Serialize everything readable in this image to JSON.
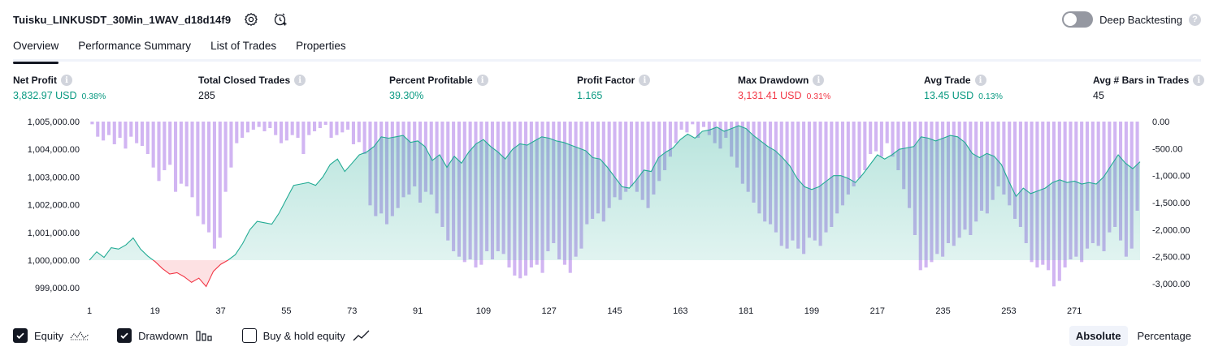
{
  "header": {
    "title": "Tuisku_LINKUSDT_30Min_1WAV_d18d14f9",
    "deep_backtesting_label": "Deep Backtesting",
    "deep_backtesting_enabled": false,
    "help_glyph": "?"
  },
  "tabs": [
    {
      "label": "Overview",
      "active": true
    },
    {
      "label": "Performance Summary",
      "active": false
    },
    {
      "label": "List of Trades",
      "active": false
    },
    {
      "label": "Properties",
      "active": false
    }
  ],
  "info_glyph": "i",
  "metrics": [
    {
      "label": "Net Profit",
      "value": "3,832.97 USD",
      "pct": "0.38%",
      "tone": "pos"
    },
    {
      "label": "Total Closed Trades",
      "value": "285",
      "pct": "",
      "tone": "neu"
    },
    {
      "label": "Percent Profitable",
      "value": "39.30%",
      "pct": "",
      "tone": "pos"
    },
    {
      "label": "Profit Factor",
      "value": "1.165",
      "pct": "",
      "tone": "pos"
    },
    {
      "label": "Max Drawdown",
      "value": "3,131.41 USD",
      "pct": "0.31%",
      "tone": "neg"
    },
    {
      "label": "Avg Trade",
      "value": "13.45 USD",
      "pct": "0.13%",
      "tone": "pos"
    },
    {
      "label": "Avg # Bars in Trades",
      "value": "45",
      "pct": "",
      "tone": "neu"
    }
  ],
  "chart_data": {
    "type": "area",
    "x_ticks": [
      "1",
      "19",
      "37",
      "55",
      "73",
      "91",
      "109",
      "127",
      "145",
      "163",
      "181",
      "199",
      "217",
      "235",
      "253",
      "271"
    ],
    "x_range": [
      1,
      289
    ],
    "left_axis": {
      "ticks": [
        "1,005,000.00",
        "1,004,000.00",
        "1,003,000.00",
        "1,002,000.00",
        "1,001,000.00",
        "1,000,000.00",
        "999,000.00"
      ],
      "range": [
        998500,
        1005000
      ]
    },
    "right_axis": {
      "ticks": [
        "0.00",
        "-500.00",
        "-1,000.00",
        "-1,500.00",
        "-2,000.00",
        "-2,500.00",
        "-3,000.00"
      ],
      "range": [
        -3100,
        0
      ]
    },
    "series": [
      {
        "name": "Equity",
        "kind": "area",
        "baseline": 1000000,
        "points": [
          [
            1,
            1000000
          ],
          [
            3,
            1000300
          ],
          [
            5,
            1000100
          ],
          [
            7,
            1000450
          ],
          [
            9,
            1000400
          ],
          [
            11,
            1000550
          ],
          [
            13,
            1000800
          ],
          [
            15,
            1000400
          ],
          [
            17,
            1000150
          ],
          [
            19,
            999950
          ],
          [
            21,
            999700
          ],
          [
            23,
            999500
          ],
          [
            25,
            999550
          ],
          [
            27,
            999400
          ],
          [
            29,
            999200
          ],
          [
            31,
            999350
          ],
          [
            33,
            999050
          ],
          [
            35,
            999600
          ],
          [
            37,
            999850
          ],
          [
            39,
            1000000
          ],
          [
            41,
            1000200
          ],
          [
            43,
            1000600
          ],
          [
            45,
            1001100
          ],
          [
            47,
            1001400
          ],
          [
            49,
            1001350
          ],
          [
            51,
            1001300
          ],
          [
            53,
            1001700
          ],
          [
            55,
            1002200
          ],
          [
            57,
            1002700
          ],
          [
            59,
            1002750
          ],
          [
            61,
            1002800
          ],
          [
            63,
            1002700
          ],
          [
            65,
            1003000
          ],
          [
            67,
            1003450
          ],
          [
            69,
            1003650
          ],
          [
            71,
            1003200
          ],
          [
            73,
            1003500
          ],
          [
            75,
            1003800
          ],
          [
            77,
            1003900
          ],
          [
            79,
            1004100
          ],
          [
            81,
            1004450
          ],
          [
            83,
            1004400
          ],
          [
            85,
            1004450
          ],
          [
            87,
            1004500
          ],
          [
            89,
            1004250
          ],
          [
            91,
            1004300
          ],
          [
            93,
            1004100
          ],
          [
            95,
            1003600
          ],
          [
            97,
            1003800
          ],
          [
            99,
            1003350
          ],
          [
            101,
            1003750
          ],
          [
            103,
            1003500
          ],
          [
            105,
            1003900
          ],
          [
            107,
            1004200
          ],
          [
            109,
            1004350
          ],
          [
            111,
            1004100
          ],
          [
            113,
            1003900
          ],
          [
            115,
            1003650
          ],
          [
            117,
            1004000
          ],
          [
            119,
            1004200
          ],
          [
            121,
            1004150
          ],
          [
            123,
            1004300
          ],
          [
            125,
            1004450
          ],
          [
            127,
            1004400
          ],
          [
            129,
            1004300
          ],
          [
            131,
            1004250
          ],
          [
            133,
            1004150
          ],
          [
            135,
            1004050
          ],
          [
            137,
            1003950
          ],
          [
            139,
            1003700
          ],
          [
            141,
            1003650
          ],
          [
            143,
            1003350
          ],
          [
            145,
            1003000
          ],
          [
            147,
            1002650
          ],
          [
            149,
            1002600
          ],
          [
            151,
            1002900
          ],
          [
            153,
            1003250
          ],
          [
            155,
            1003200
          ],
          [
            157,
            1003700
          ],
          [
            159,
            1003900
          ],
          [
            161,
            1004050
          ],
          [
            163,
            1004350
          ],
          [
            165,
            1004550
          ],
          [
            167,
            1004400
          ],
          [
            169,
            1004650
          ],
          [
            171,
            1004700
          ],
          [
            173,
            1004800
          ],
          [
            175,
            1004650
          ],
          [
            177,
            1004750
          ],
          [
            179,
            1004850
          ],
          [
            181,
            1004750
          ],
          [
            183,
            1004500
          ],
          [
            185,
            1004300
          ],
          [
            187,
            1004100
          ],
          [
            189,
            1003950
          ],
          [
            191,
            1003700
          ],
          [
            193,
            1003400
          ],
          [
            195,
            1002950
          ],
          [
            197,
            1002650
          ],
          [
            199,
            1002550
          ],
          [
            201,
            1002650
          ],
          [
            203,
            1002850
          ],
          [
            205,
            1003050
          ],
          [
            207,
            1003050
          ],
          [
            209,
            1002950
          ],
          [
            211,
            1002800
          ],
          [
            213,
            1003100
          ],
          [
            215,
            1003450
          ],
          [
            217,
            1003800
          ],
          [
            219,
            1003650
          ],
          [
            221,
            1003800
          ],
          [
            223,
            1004000
          ],
          [
            225,
            1004050
          ],
          [
            227,
            1004100
          ],
          [
            229,
            1004450
          ],
          [
            231,
            1004400
          ],
          [
            233,
            1004300
          ],
          [
            235,
            1004400
          ],
          [
            237,
            1004500
          ],
          [
            239,
            1004450
          ],
          [
            241,
            1004250
          ],
          [
            243,
            1003850
          ],
          [
            245,
            1003700
          ],
          [
            247,
            1003850
          ],
          [
            249,
            1003750
          ],
          [
            251,
            1003450
          ],
          [
            253,
            1002850
          ],
          [
            255,
            1002300
          ],
          [
            257,
            1002600
          ],
          [
            259,
            1002400
          ],
          [
            261,
            1002500
          ],
          [
            263,
            1002600
          ],
          [
            265,
            1002800
          ],
          [
            267,
            1002900
          ],
          [
            269,
            1002800
          ],
          [
            271,
            1002850
          ],
          [
            273,
            1002750
          ],
          [
            275,
            1002800
          ],
          [
            277,
            1002750
          ],
          [
            279,
            1003000
          ],
          [
            281,
            1003400
          ],
          [
            283,
            1003800
          ],
          [
            285,
            1003500
          ],
          [
            287,
            1003300
          ],
          [
            289,
            1003550
          ]
        ]
      },
      {
        "name": "Drawdown",
        "kind": "bar",
        "axis": "right",
        "values": [
          -50,
          -280,
          -350,
          -250,
          -420,
          -300,
          -500,
          -280,
          -400,
          -450,
          -600,
          -850,
          -1100,
          -900,
          -800,
          -1300,
          -1150,
          -1200,
          -1400,
          -1750,
          -1900,
          -2050,
          -2350,
          -2150,
          -1300,
          -850,
          -400,
          -300,
          -200,
          -150,
          -100,
          -180,
          -120,
          -250,
          -400,
          -350,
          -250,
          -300,
          -600,
          -250,
          -180,
          -120,
          -60,
          -300,
          -250,
          -200,
          -150,
          -420,
          -380,
          -600,
          -1550,
          -1750,
          -1700,
          -1900,
          -1750,
          -1600,
          -1400,
          -1350,
          -1200,
          -1500,
          -1300,
          -1350,
          -1700,
          -1950,
          -2200,
          -2400,
          -2500,
          -2600,
          -2550,
          -2700,
          -2650,
          -2400,
          -2550,
          -2400,
          -2450,
          -2700,
          -2850,
          -2900,
          -2850,
          -2700,
          -2650,
          -2800,
          -2400,
          -2250,
          -2550,
          -2650,
          -2800,
          -2500,
          -2350,
          -1900,
          -1800,
          -1700,
          -1850,
          -1600,
          -1400,
          -1450,
          -1300,
          -1200,
          -1300,
          -1450,
          -1600,
          -1350,
          -1100,
          -900,
          -650,
          -400,
          -150,
          -200,
          -50,
          -300,
          -100,
          -250,
          -400,
          -500,
          -300,
          -650,
          -850,
          -1150,
          -1300,
          -1500,
          -1700,
          -1850,
          -1900,
          -2050,
          -2300,
          -2350,
          -2200,
          -2350,
          -2450,
          -2150,
          -2200,
          -2300,
          -2050,
          -1950,
          -1700,
          -1550,
          -1350,
          -1200,
          -1050,
          -900,
          -600,
          -550,
          -650,
          -400,
          -650,
          -900,
          -1250,
          -1600,
          -2100,
          -2750,
          -2700,
          -2600,
          -2450,
          -2500,
          -2250,
          -2300,
          -2150,
          -2000,
          -2100,
          -1850,
          -1650,
          -1700,
          -1450,
          -1200,
          -1350,
          -1550,
          -1800,
          -1950,
          -2250,
          -2600,
          -2700,
          -2650,
          -2750,
          -3050,
          -2950,
          -2700,
          -2550,
          -2500,
          -2600,
          -2350,
          -2250,
          -2300,
          -2400,
          -2050,
          -1950,
          -2200,
          -2500,
          -2350,
          -1650
        ]
      }
    ],
    "legend": [
      {
        "label": "Equity",
        "checked": true
      },
      {
        "label": "Drawdown",
        "checked": true
      },
      {
        "label": "Buy & hold equity",
        "checked": false
      }
    ]
  },
  "colors": {
    "equity_line": "#22ab94",
    "equity_fill": "#d3efe8",
    "equity_loss_line": "#f23645",
    "equity_loss_fill": "#fcd9dc",
    "drawdown_bar": "#c9a8f0",
    "positive": "#089981",
    "negative": "#f23645"
  },
  "mode": {
    "options": [
      "Absolute",
      "Percentage"
    ],
    "selected": "Absolute"
  }
}
